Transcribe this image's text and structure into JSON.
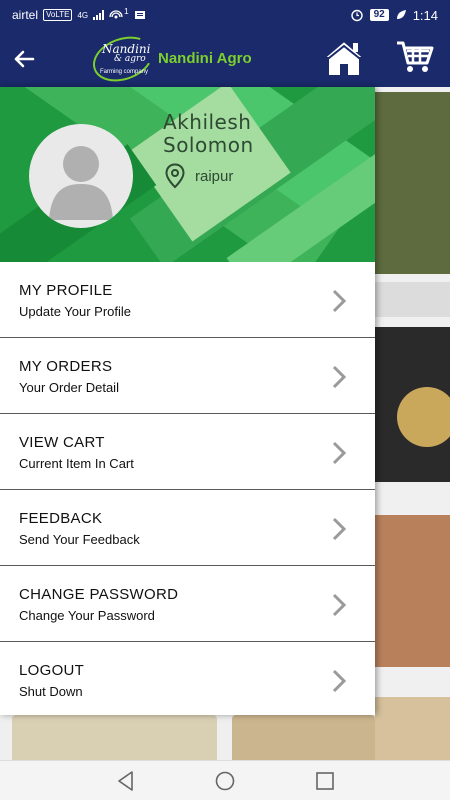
{
  "status_bar": {
    "carrier": "airtel",
    "volte": "VoLTE",
    "network": "4G",
    "hotspot_count": "1",
    "battery": "92",
    "time": "1:14"
  },
  "app_bar": {
    "logo_line1": "Nandini",
    "logo_line2": "& agro",
    "logo_tagline": "Farming company",
    "brand_name": "Nandini Agro"
  },
  "profile": {
    "first_name": "Akhilesh",
    "last_name": "Solomon",
    "location": "raipur"
  },
  "menu": [
    {
      "title": "MY PROFILE",
      "subtitle": "Update Your Profile"
    },
    {
      "title": "MY ORDERS",
      "subtitle": "Your Order Detail"
    },
    {
      "title": "VIEW CART",
      "subtitle": "Current Item In Cart"
    },
    {
      "title": "FEEDBACK",
      "subtitle": "Send Your Feedback"
    },
    {
      "title": "CHANGE PASSWORD",
      "subtitle": "Change Your Password"
    },
    {
      "title": "LOGOUT",
      "subtitle": "Shut Down"
    }
  ],
  "icons": {
    "back": "back-arrow-icon",
    "home": "home-icon",
    "cart": "cart-icon",
    "location": "location-pin-icon",
    "chevron": "chevron-right-icon"
  },
  "colors": {
    "app_bar": "#1a2a6b",
    "brand_green": "#7ccf2c",
    "header_green": "#1f9a40",
    "text_dark": "#111111"
  }
}
